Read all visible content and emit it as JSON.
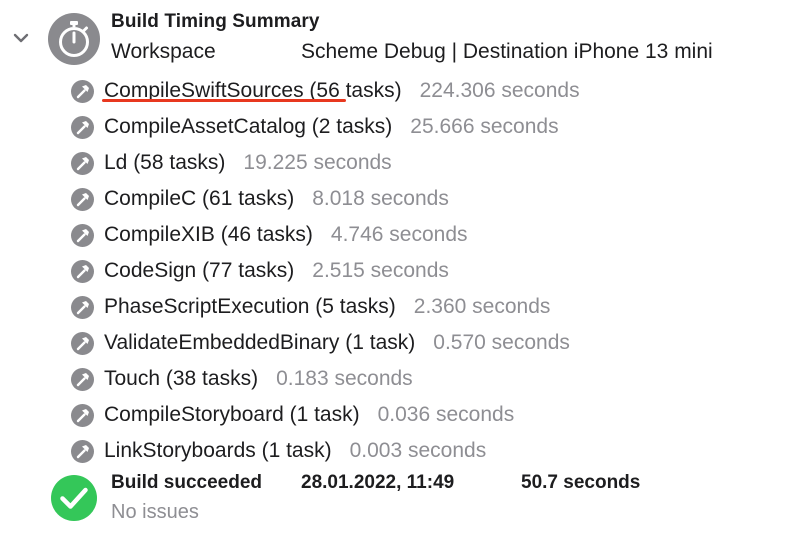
{
  "summary": {
    "title": "Build Timing Summary",
    "workspace": "Workspace",
    "scheme_destination": "Scheme Debug | Destination iPhone 13 mini"
  },
  "tasks": [
    {
      "name": "CompileSwiftSources (56 tasks)",
      "time": "224.306 seconds"
    },
    {
      "name": "CompileAssetCatalog (2 tasks)",
      "time": "25.666 seconds"
    },
    {
      "name": "Ld (58 tasks)",
      "time": "19.225 seconds"
    },
    {
      "name": "CompileC (61 tasks)",
      "time": "8.018 seconds"
    },
    {
      "name": "CompileXIB (46 tasks)",
      "time": "4.746 seconds"
    },
    {
      "name": "CodeSign (77 tasks)",
      "time": "2.515 seconds"
    },
    {
      "name": "PhaseScriptExecution (5 tasks)",
      "time": "2.360 seconds"
    },
    {
      "name": "ValidateEmbeddedBinary (1 task)",
      "time": "0.570 seconds"
    },
    {
      "name": "Touch (38 tasks)",
      "time": "0.183 seconds"
    },
    {
      "name": "CompileStoryboard (1 task)",
      "time": "0.036 seconds"
    },
    {
      "name": "LinkStoryboards (1 task)",
      "time": "0.003 seconds"
    }
  ],
  "result": {
    "status": "Build succeeded",
    "date": "28.01.2022, 11:49",
    "duration": "50.7 seconds",
    "issues": "No issues"
  },
  "icons": {
    "disclosure": "chevron-down-icon",
    "header": "stopwatch-icon",
    "task": "hammer-icon",
    "success": "checkmark-circle-icon"
  },
  "colors": {
    "task_icon": "#8a8a8e",
    "secondary_text": "#8e8e93",
    "success": "#34c759",
    "annotation": "#e8381f"
  }
}
